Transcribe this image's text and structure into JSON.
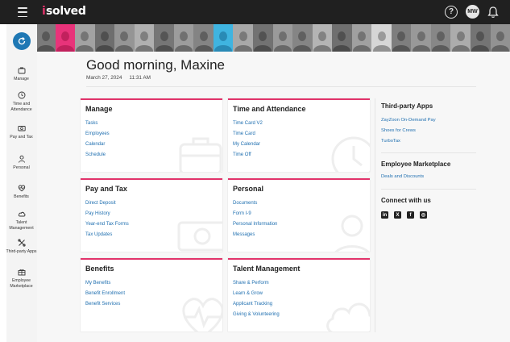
{
  "header": {
    "logo_mark": "i",
    "logo_text": "solved",
    "help_label": "?",
    "user_initials": "MW"
  },
  "sidebar": {
    "items": [
      {
        "label": "Manage",
        "icon": "briefcase-icon"
      },
      {
        "label": "Time and Attendance",
        "icon": "clock-icon"
      },
      {
        "label": "Pay and Tax",
        "icon": "money-icon"
      },
      {
        "label": "Personal",
        "icon": "person-icon"
      },
      {
        "label": "Benefits",
        "icon": "heart-pulse-icon"
      },
      {
        "label": "Talent Management",
        "icon": "cloud-icon"
      },
      {
        "label": "Third-party Apps",
        "icon": "tools-icon"
      },
      {
        "label": "Employee Marketplace",
        "icon": "gift-icon"
      }
    ]
  },
  "greeting": {
    "text": "Good morning, Maxine",
    "date": "March 27, 2024",
    "time": "11:31 AM"
  },
  "cards": [
    {
      "title": "Manage",
      "links": [
        "Tasks",
        "Employees",
        "Calendar",
        "Schedule"
      ],
      "icon": "briefcase-icon"
    },
    {
      "title": "Time and Attendance",
      "links": [
        "Time Card V2",
        "Time Card",
        "My Calendar",
        "Time Off"
      ],
      "icon": "clock-icon"
    },
    {
      "title": "Pay and Tax",
      "links": [
        "Direct Deposit",
        "Pay History",
        "Year-end Tax Forms",
        "Tax Updates"
      ],
      "icon": "money-icon"
    },
    {
      "title": "Personal",
      "links": [
        "Documents",
        "Form I-9",
        "Personal Information",
        "Messages"
      ],
      "icon": "person-icon"
    },
    {
      "title": "Benefits",
      "links": [
        "My Benefits",
        "Benefit Enrollment",
        "Benefit Services"
      ],
      "icon": "heart-pulse-icon"
    },
    {
      "title": "Talent Management",
      "links": [
        "Share & Perform",
        "Learn & Grow",
        "Applicant Tracking",
        "Giving & Volunteering"
      ],
      "icon": "cloud-icon"
    }
  ],
  "right_panel": {
    "third_party_title": "Third-party Apps",
    "third_party_links": [
      "ZayZoon On-Demand Pay",
      "Shoes for Crews",
      "TurboTax"
    ],
    "marketplace_title": "Employee Marketplace",
    "marketplace_links": [
      "Deals and Discounts"
    ],
    "connect_title": "Connect with us",
    "social": [
      {
        "label": "in",
        "icon": "linkedin-icon"
      },
      {
        "label": "X",
        "icon": "x-icon"
      },
      {
        "label": "f",
        "icon": "facebook-icon"
      },
      {
        "label": "◎",
        "icon": "instagram-icon"
      }
    ]
  },
  "colors": {
    "accent": "#e2336b",
    "link": "#1f6fb0",
    "topbar": "#202020",
    "refresh": "#1f78b4"
  }
}
